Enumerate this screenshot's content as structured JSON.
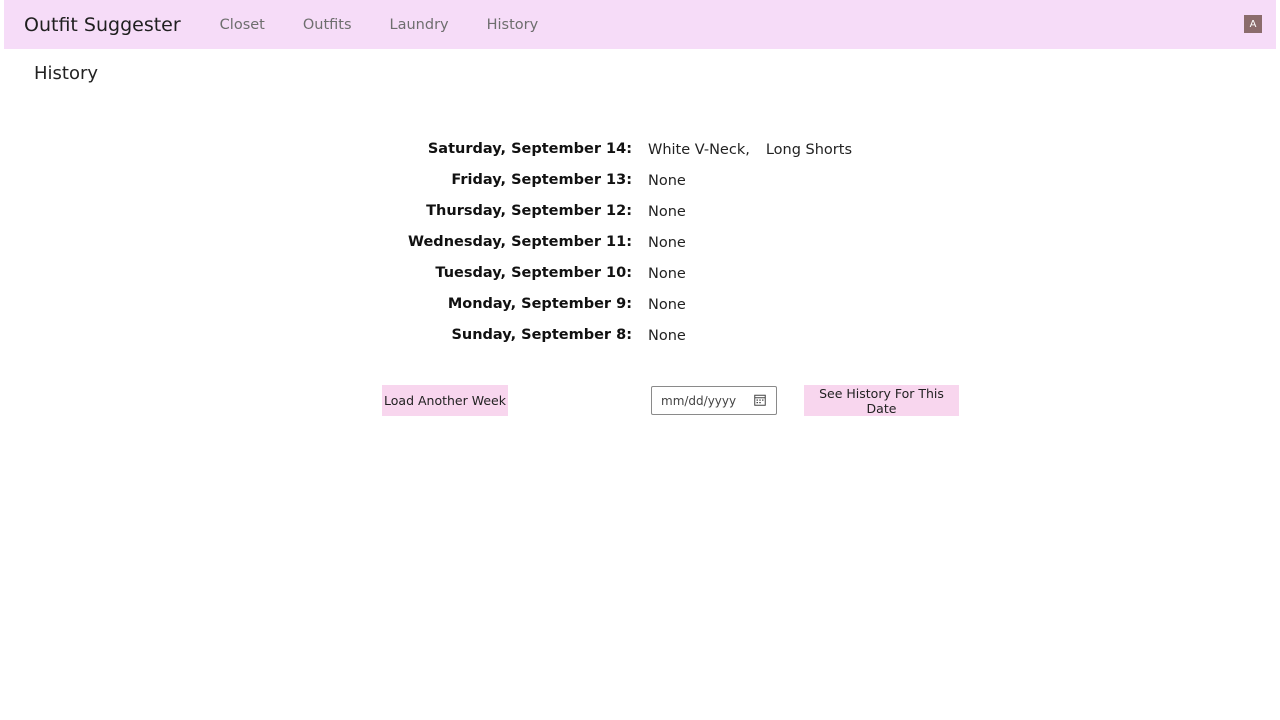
{
  "nav": {
    "brand": "Outfit Suggester",
    "links": [
      "Closet",
      "Outfits",
      "Laundry",
      "History"
    ],
    "avatar_letter": "A"
  },
  "page": {
    "title": "History"
  },
  "history": [
    {
      "day": "Saturday, September 14:",
      "items": [
        "White V-Neck,",
        "Long Shorts"
      ]
    },
    {
      "day": "Friday, September 13:",
      "items": [
        "None"
      ]
    },
    {
      "day": "Thursday, September 12:",
      "items": [
        "None"
      ]
    },
    {
      "day": "Wednesday, September 11:",
      "items": [
        "None"
      ]
    },
    {
      "day": "Tuesday, September 10:",
      "items": [
        "None"
      ]
    },
    {
      "day": "Monday, September 9:",
      "items": [
        "None"
      ]
    },
    {
      "day": "Sunday, September 8:",
      "items": [
        "None"
      ]
    }
  ],
  "controls": {
    "load_week_label": "Load Another Week",
    "date_placeholder": "mm/dd/yyyy",
    "see_history_label": "See History For This Date"
  },
  "icons": {
    "date_picker": "calendar-icon"
  },
  "colors": {
    "navbar_bg": "#f6dcf8",
    "button_bg": "#f8d6ee",
    "avatar_bg": "#8b6c6c"
  }
}
